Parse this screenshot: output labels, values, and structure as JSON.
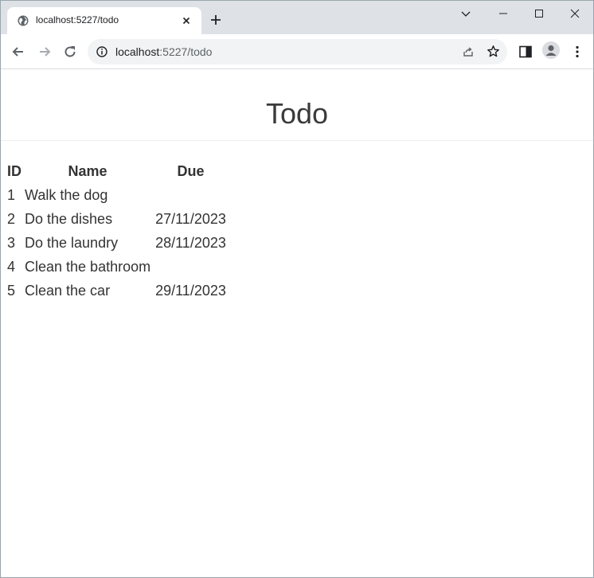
{
  "browser": {
    "tab": {
      "title": "localhost:5227/todo",
      "favicon": "globe-icon"
    },
    "new_tab_icon": "plus-icon",
    "window_controls": [
      "chevron-down-icon",
      "minimize-icon",
      "maximize-icon",
      "close-icon"
    ],
    "address_bar": {
      "host": "localhost",
      "path": ":5227/todo",
      "security_icon": "info-icon"
    },
    "toolbar_icons": [
      "back-arrow-icon",
      "forward-arrow-icon",
      "reload-icon",
      "share-icon",
      "star-icon",
      "side-panel-icon",
      "profile-icon",
      "more-vertical-icon"
    ]
  },
  "page": {
    "title": "Todo",
    "table": {
      "headers": {
        "id": "ID",
        "name": "Name",
        "due": "Due"
      },
      "rows": [
        {
          "id": "1",
          "name": "Walk the dog",
          "due": ""
        },
        {
          "id": "2",
          "name": "Do the dishes",
          "due": "27/11/2023"
        },
        {
          "id": "3",
          "name": "Do the laundry",
          "due": "28/11/2023"
        },
        {
          "id": "4",
          "name": "Clean the bathroom",
          "due": ""
        },
        {
          "id": "5",
          "name": "Clean the car",
          "due": "29/11/2023"
        }
      ]
    }
  },
  "colors": {
    "tabstrip": "#dee1e6",
    "omnibox": "#f1f3f4",
    "text": "#333333",
    "icon": "#5f6368"
  }
}
